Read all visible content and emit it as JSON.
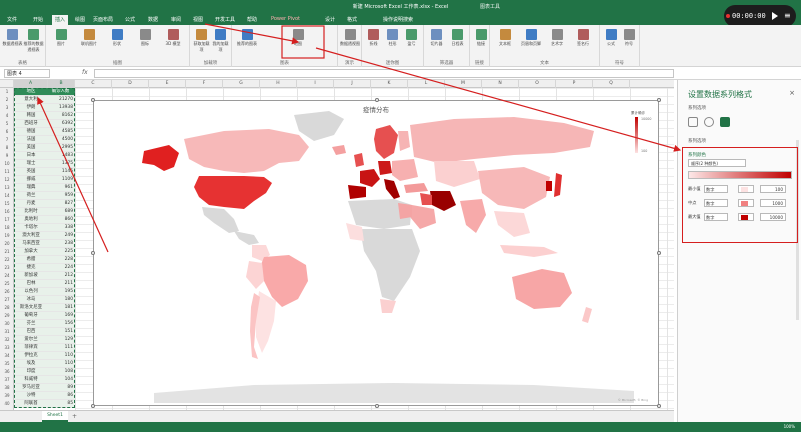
{
  "window": {
    "title": "新建 Microsoft Excel 工作表.xlsx - Excel",
    "context_tab": "图表工具"
  },
  "tabs": [
    {
      "label": "文件"
    },
    {
      "label": "开始"
    },
    {
      "label": "插入",
      "active": true
    },
    {
      "label": "绘图"
    },
    {
      "label": "页面布局"
    },
    {
      "label": "公式"
    },
    {
      "label": "数据"
    },
    {
      "label": "审阅"
    },
    {
      "label": "视图"
    },
    {
      "label": "开发工具"
    },
    {
      "label": "帮助"
    },
    {
      "label": "Power Pivot"
    },
    {
      "label": "设计"
    },
    {
      "label": "格式"
    },
    {
      "label": "操作说明搜索"
    }
  ],
  "recorder": {
    "time": "00:00:00"
  },
  "ribbon": {
    "groups": [
      {
        "label": "表格",
        "buttons": [
          "数据透视表",
          "推荐的数据透视表"
        ]
      },
      {
        "label": "插图",
        "buttons": [
          "图片",
          "联机图片",
          "形状",
          "图标",
          "3D 模型"
        ]
      },
      {
        "label": "加载项",
        "buttons": [
          "获取加载项",
          "我的加载项"
        ]
      },
      {
        "label": "图表",
        "buttons": [
          "推荐的图表",
          "地图"
        ]
      },
      {
        "label": "演示",
        "buttons": [
          "数据透视图"
        ]
      },
      {
        "label": "迷你图",
        "buttons": [
          "折线",
          "柱形",
          "盈亏"
        ]
      },
      {
        "label": "筛选器",
        "buttons": [
          "切片器",
          "日程表"
        ]
      },
      {
        "label": "链接",
        "buttons": [
          "链接"
        ]
      },
      {
        "label": "文本",
        "buttons": [
          "文本框",
          "页眉和页脚",
          "艺术字",
          "签名行"
        ]
      },
      {
        "label": "符号",
        "buttons": [
          "公式",
          "符号"
        ]
      }
    ]
  },
  "formula_bar": {
    "name_box": "图表 4",
    "fx": "fx",
    "value": ""
  },
  "grid": {
    "columns": [
      "A",
      "B",
      "C",
      "D",
      "E",
      "F",
      "G",
      "H",
      "I",
      "J",
      "K",
      "L",
      "M",
      "N",
      "O",
      "P",
      "Q"
    ],
    "header": [
      "地区",
      "确诊人数"
    ],
    "rows": [
      [
        "意大利",
        "21270"
      ],
      [
        "伊朗",
        "13938"
      ],
      [
        "韩国",
        "8162"
      ],
      [
        "西班牙",
        "6392"
      ],
      [
        "德国",
        "4585"
      ],
      [
        "法国",
        "4500"
      ],
      [
        "美国",
        "2995"
      ],
      [
        "日本",
        "1483"
      ],
      [
        "瑞士",
        "1375"
      ],
      [
        "英国",
        "1145"
      ],
      [
        "挪威",
        "1109"
      ],
      [
        "瑞典",
        "961"
      ],
      [
        "荷兰",
        "959"
      ],
      [
        "丹麦",
        "827"
      ],
      [
        "比利时",
        "689"
      ],
      [
        "奥地利",
        "860"
      ],
      [
        "卡塔尔",
        "338"
      ],
      [
        "澳大利亚",
        "249"
      ],
      [
        "马来西亚",
        "238"
      ],
      [
        "加拿大",
        "225"
      ],
      [
        "希腊",
        "228"
      ],
      [
        "捷克",
        "224"
      ],
      [
        "新加坡",
        "212"
      ],
      [
        "巴林",
        "211"
      ],
      [
        "以色列",
        "195"
      ],
      [
        "冰岛",
        "180"
      ],
      [
        "斯洛文尼亚",
        "181"
      ],
      [
        "葡萄牙",
        "169"
      ],
      [
        "芬兰",
        "156"
      ],
      [
        "巴西",
        "151"
      ],
      [
        "爱尔兰",
        "129"
      ],
      [
        "菲律宾",
        "111"
      ],
      [
        "伊拉克",
        "110"
      ],
      [
        "埃及",
        "110"
      ],
      [
        "印度",
        "108"
      ],
      [
        "科威特",
        "104"
      ],
      [
        "罗马尼亚",
        "89"
      ],
      [
        "沙特",
        "86"
      ],
      [
        "阿联酋",
        "85"
      ]
    ]
  },
  "chart": {
    "title": "疫情分布",
    "legend_title": "累计确诊",
    "legend_max": "10000",
    "legend_min": "100",
    "attribution": "© Microsoft, © Bing"
  },
  "chart_data": {
    "type": "table",
    "title": "疫情分布",
    "columns": [
      "地区",
      "确诊人数"
    ],
    "rows": [
      [
        "意大利",
        21270
      ],
      [
        "伊朗",
        13938
      ],
      [
        "韩国",
        8162
      ],
      [
        "西班牙",
        6392
      ],
      [
        "德国",
        4585
      ],
      [
        "法国",
        4500
      ],
      [
        "美国",
        2995
      ],
      [
        "日本",
        1483
      ],
      [
        "瑞士",
        1375
      ],
      [
        "英国",
        1145
      ],
      [
        "挪威",
        1109
      ],
      [
        "瑞典",
        961
      ],
      [
        "荷兰",
        959
      ],
      [
        "丹麦",
        827
      ],
      [
        "比利时",
        689
      ],
      [
        "奥地利",
        860
      ],
      [
        "卡塔尔",
        338
      ],
      [
        "澳大利亚",
        249
      ],
      [
        "马来西亚",
        238
      ],
      [
        "加拿大",
        225
      ],
      [
        "希腊",
        228
      ],
      [
        "捷克",
        224
      ],
      [
        "新加坡",
        212
      ],
      [
        "巴林",
        211
      ],
      [
        "以色列",
        195
      ],
      [
        "冰岛",
        180
      ],
      [
        "斯洛文尼亚",
        181
      ],
      [
        "葡萄牙",
        169
      ],
      [
        "芬兰",
        156
      ],
      [
        "巴西",
        151
      ],
      [
        "爱尔兰",
        129
      ],
      [
        "菲律宾",
        111
      ],
      [
        "伊拉克",
        110
      ],
      [
        "埃及",
        110
      ],
      [
        "印度",
        108
      ],
      [
        "科威特",
        104
      ],
      [
        "罗马尼亚",
        89
      ],
      [
        "沙特",
        86
      ],
      [
        "阿联酋",
        85
      ]
    ]
  },
  "sheet": {
    "tab": "Sheet1",
    "add": "+"
  },
  "status": {
    "zoom": "100%"
  },
  "pane": {
    "title": "设置数据系列格式",
    "close": "×",
    "subtitle": "系列选项",
    "section_options": "系列选项",
    "section_color": "系列颜色",
    "color_mode": "顺序(2 种颜色)",
    "stops": [
      {
        "label": "最小值",
        "type": "数字",
        "value": "100",
        "color": "#fde2e2"
      },
      {
        "label": "中点",
        "type": "数字",
        "value": "1000",
        "color": "#f08080"
      },
      {
        "label": "最大值",
        "type": "数字",
        "value": "10000",
        "color": "#c00000"
      }
    ]
  },
  "colors": {
    "excel_green": "#217346",
    "annotation_red": "#d51f1f",
    "map_high": "#c00000",
    "map_low": "#fde2e2",
    "map_nodata": "#d9d9d9"
  }
}
